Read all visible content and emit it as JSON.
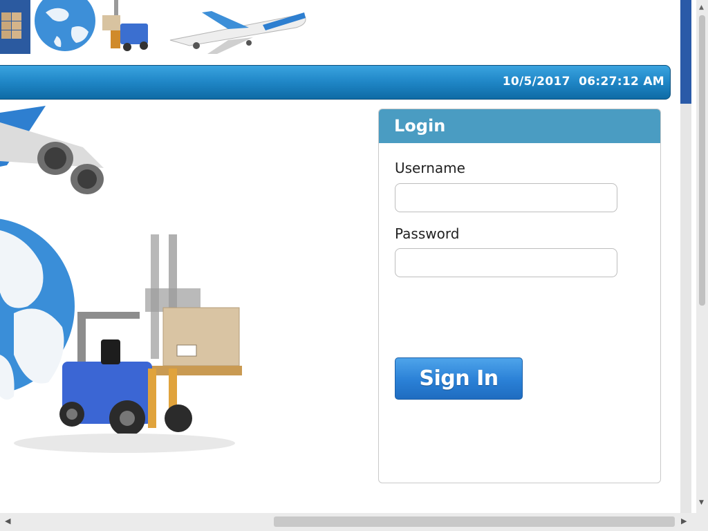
{
  "header": {
    "datetime": "10/5/2017  06:27:12 AM"
  },
  "login": {
    "title": "Login",
    "username_label": "Username",
    "username_value": "",
    "password_label": "Password",
    "password_value": "",
    "signin_label": "Sign In"
  },
  "colors": {
    "bar_blue": "#1f86c6",
    "login_header": "#4a9cc2",
    "button_blue": "#2a80d6"
  },
  "icons": {
    "scroll_up": "▲",
    "scroll_down": "▼",
    "scroll_left": "◀",
    "scroll_right": "▶"
  }
}
